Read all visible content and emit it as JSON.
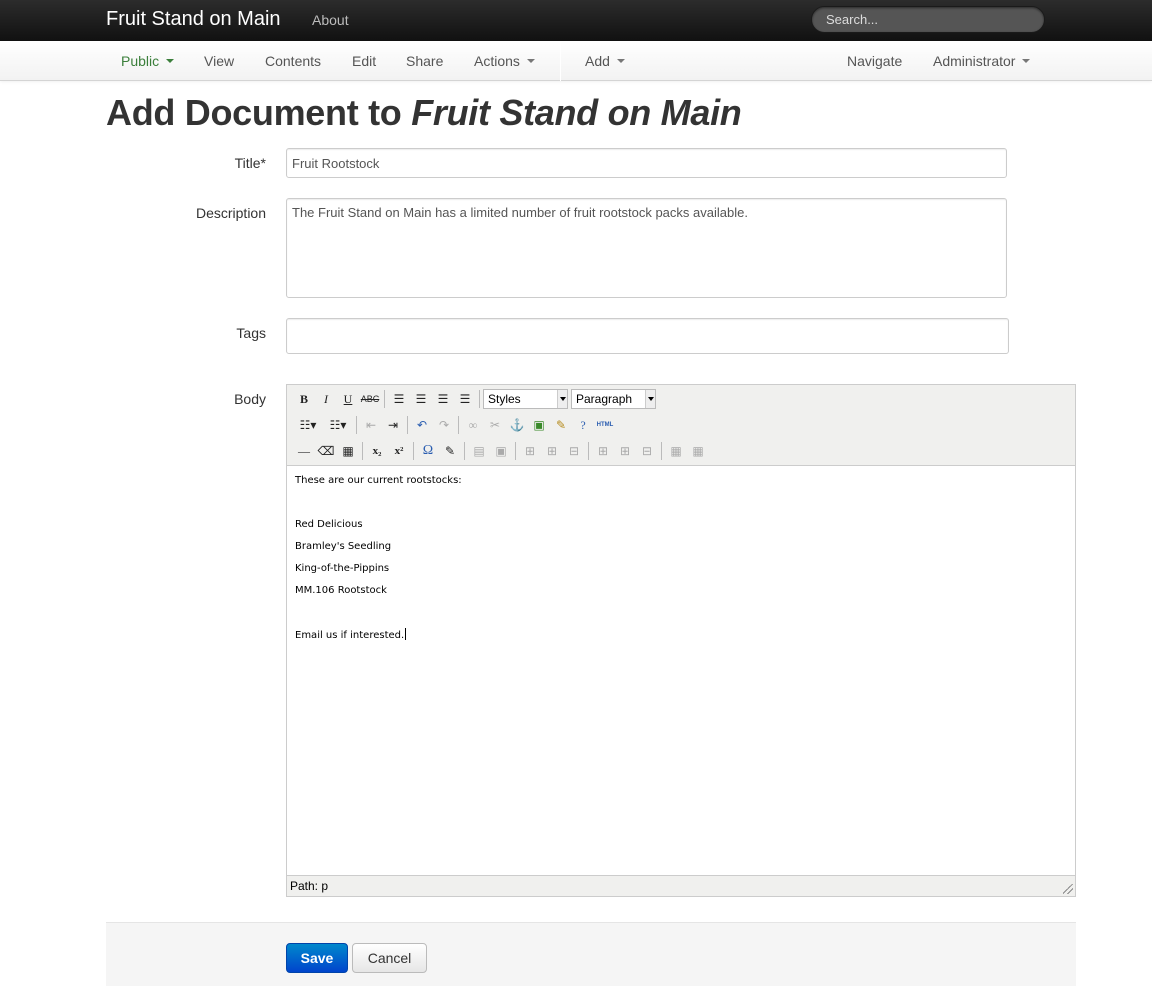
{
  "topbar": {
    "brand": "Fruit Stand on Main",
    "about": "About",
    "search_placeholder": "Search..."
  },
  "subnav": {
    "items": [
      "Public",
      "View",
      "Contents",
      "Edit",
      "Share",
      "Actions",
      "Add",
      "Navigate",
      "Administrator"
    ],
    "active": "Public"
  },
  "page": {
    "heading_prefix": "Add Document to ",
    "heading_context": "Fruit Stand on Main"
  },
  "form": {
    "title_label": "Title*",
    "title_value": "Fruit Rootstock",
    "description_label": "Description",
    "description_value": "The Fruit Stand on Main has a limited number of fruit rootstock packs available.",
    "tags_label": "Tags",
    "tags_value": "",
    "body_label": "Body"
  },
  "editor": {
    "styles_select": "Styles",
    "format_select": "Paragraph",
    "html_button": "HTML",
    "content": [
      "These are our current rootstocks:",
      "",
      "Red Delicious",
      "Bramley's Seedling",
      "King-of-the-Pippins",
      "MM.106 Rootstock",
      "",
      "Email us if interested."
    ],
    "path": "Path: p"
  },
  "buttons": {
    "save": "Save",
    "cancel": "Cancel"
  },
  "colors": {
    "active_nav": "#3b7f3b",
    "primary_button": "#0066cc",
    "topbar": "#1b1b1b"
  }
}
